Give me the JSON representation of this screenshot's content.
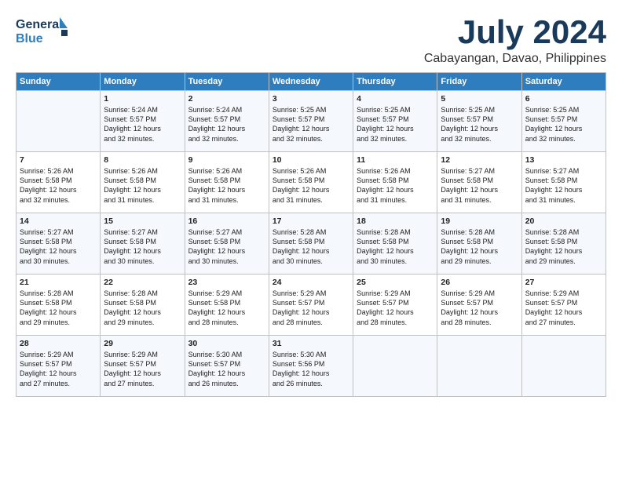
{
  "header": {
    "logo_general": "General",
    "logo_blue": "Blue",
    "month": "July 2024",
    "location": "Cabayangan, Davao, Philippines"
  },
  "days_of_week": [
    "Sunday",
    "Monday",
    "Tuesday",
    "Wednesday",
    "Thursday",
    "Friday",
    "Saturday"
  ],
  "weeks": [
    [
      {
        "day": "",
        "content": ""
      },
      {
        "day": "1",
        "content": "Sunrise: 5:24 AM\nSunset: 5:57 PM\nDaylight: 12 hours\nand 32 minutes."
      },
      {
        "day": "2",
        "content": "Sunrise: 5:24 AM\nSunset: 5:57 PM\nDaylight: 12 hours\nand 32 minutes."
      },
      {
        "day": "3",
        "content": "Sunrise: 5:25 AM\nSunset: 5:57 PM\nDaylight: 12 hours\nand 32 minutes."
      },
      {
        "day": "4",
        "content": "Sunrise: 5:25 AM\nSunset: 5:57 PM\nDaylight: 12 hours\nand 32 minutes."
      },
      {
        "day": "5",
        "content": "Sunrise: 5:25 AM\nSunset: 5:57 PM\nDaylight: 12 hours\nand 32 minutes."
      },
      {
        "day": "6",
        "content": "Sunrise: 5:25 AM\nSunset: 5:57 PM\nDaylight: 12 hours\nand 32 minutes."
      }
    ],
    [
      {
        "day": "7",
        "content": "Sunrise: 5:26 AM\nSunset: 5:58 PM\nDaylight: 12 hours\nand 32 minutes."
      },
      {
        "day": "8",
        "content": "Sunrise: 5:26 AM\nSunset: 5:58 PM\nDaylight: 12 hours\nand 31 minutes."
      },
      {
        "day": "9",
        "content": "Sunrise: 5:26 AM\nSunset: 5:58 PM\nDaylight: 12 hours\nand 31 minutes."
      },
      {
        "day": "10",
        "content": "Sunrise: 5:26 AM\nSunset: 5:58 PM\nDaylight: 12 hours\nand 31 minutes."
      },
      {
        "day": "11",
        "content": "Sunrise: 5:26 AM\nSunset: 5:58 PM\nDaylight: 12 hours\nand 31 minutes."
      },
      {
        "day": "12",
        "content": "Sunrise: 5:27 AM\nSunset: 5:58 PM\nDaylight: 12 hours\nand 31 minutes."
      },
      {
        "day": "13",
        "content": "Sunrise: 5:27 AM\nSunset: 5:58 PM\nDaylight: 12 hours\nand 31 minutes."
      }
    ],
    [
      {
        "day": "14",
        "content": "Sunrise: 5:27 AM\nSunset: 5:58 PM\nDaylight: 12 hours\nand 30 minutes."
      },
      {
        "day": "15",
        "content": "Sunrise: 5:27 AM\nSunset: 5:58 PM\nDaylight: 12 hours\nand 30 minutes."
      },
      {
        "day": "16",
        "content": "Sunrise: 5:27 AM\nSunset: 5:58 PM\nDaylight: 12 hours\nand 30 minutes."
      },
      {
        "day": "17",
        "content": "Sunrise: 5:28 AM\nSunset: 5:58 PM\nDaylight: 12 hours\nand 30 minutes."
      },
      {
        "day": "18",
        "content": "Sunrise: 5:28 AM\nSunset: 5:58 PM\nDaylight: 12 hours\nand 30 minutes."
      },
      {
        "day": "19",
        "content": "Sunrise: 5:28 AM\nSunset: 5:58 PM\nDaylight: 12 hours\nand 29 minutes."
      },
      {
        "day": "20",
        "content": "Sunrise: 5:28 AM\nSunset: 5:58 PM\nDaylight: 12 hours\nand 29 minutes."
      }
    ],
    [
      {
        "day": "21",
        "content": "Sunrise: 5:28 AM\nSunset: 5:58 PM\nDaylight: 12 hours\nand 29 minutes."
      },
      {
        "day": "22",
        "content": "Sunrise: 5:28 AM\nSunset: 5:58 PM\nDaylight: 12 hours\nand 29 minutes."
      },
      {
        "day": "23",
        "content": "Sunrise: 5:29 AM\nSunset: 5:58 PM\nDaylight: 12 hours\nand 28 minutes."
      },
      {
        "day": "24",
        "content": "Sunrise: 5:29 AM\nSunset: 5:57 PM\nDaylight: 12 hours\nand 28 minutes."
      },
      {
        "day": "25",
        "content": "Sunrise: 5:29 AM\nSunset: 5:57 PM\nDaylight: 12 hours\nand 28 minutes."
      },
      {
        "day": "26",
        "content": "Sunrise: 5:29 AM\nSunset: 5:57 PM\nDaylight: 12 hours\nand 28 minutes."
      },
      {
        "day": "27",
        "content": "Sunrise: 5:29 AM\nSunset: 5:57 PM\nDaylight: 12 hours\nand 27 minutes."
      }
    ],
    [
      {
        "day": "28",
        "content": "Sunrise: 5:29 AM\nSunset: 5:57 PM\nDaylight: 12 hours\nand 27 minutes."
      },
      {
        "day": "29",
        "content": "Sunrise: 5:29 AM\nSunset: 5:57 PM\nDaylight: 12 hours\nand 27 minutes."
      },
      {
        "day": "30",
        "content": "Sunrise: 5:30 AM\nSunset: 5:57 PM\nDaylight: 12 hours\nand 26 minutes."
      },
      {
        "day": "31",
        "content": "Sunrise: 5:30 AM\nSunset: 5:56 PM\nDaylight: 12 hours\nand 26 minutes."
      },
      {
        "day": "",
        "content": ""
      },
      {
        "day": "",
        "content": ""
      },
      {
        "day": "",
        "content": ""
      }
    ]
  ]
}
